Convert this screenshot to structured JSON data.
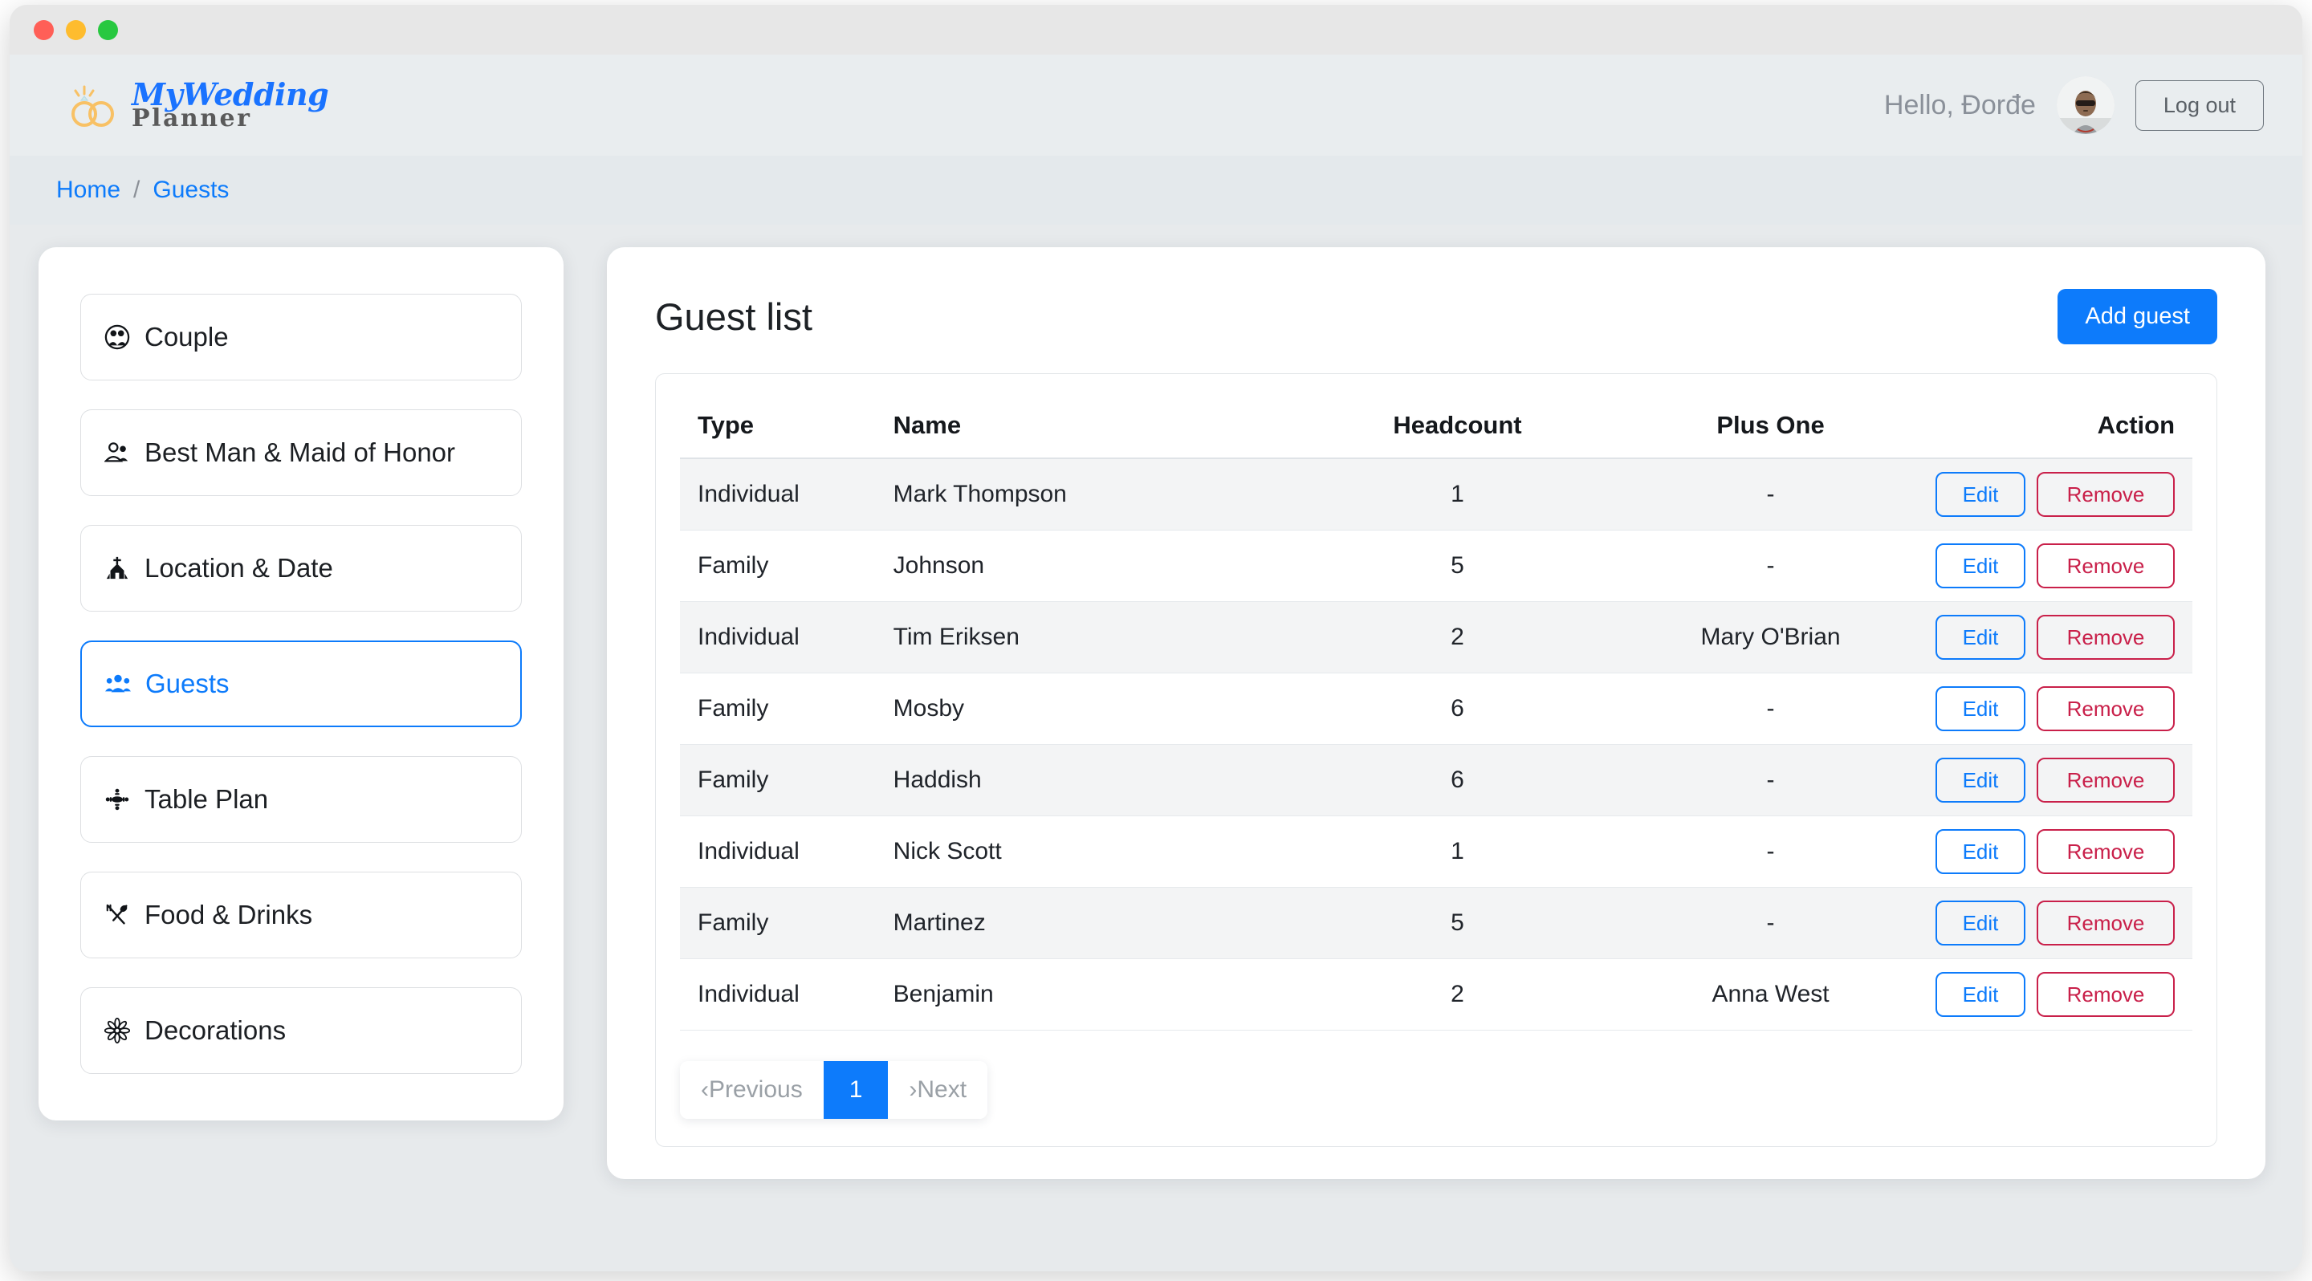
{
  "window": {
    "controls": [
      "close",
      "minimize",
      "maximize"
    ]
  },
  "header": {
    "logo": {
      "line1": "MyWedding",
      "line2": "Planner",
      "icon": "wedding-rings-icon",
      "color_blue": "#1a73ff",
      "color_grey": "#5a5a5a",
      "ring_color": "#f8c165"
    },
    "greeting": "Hello, Đorđe",
    "avatar_alt": "user-avatar",
    "logout_label": "Log out"
  },
  "breadcrumb": {
    "items": [
      {
        "label": "Home",
        "link": true
      },
      {
        "label": "Guests",
        "link": true
      }
    ],
    "separator": "/"
  },
  "sidebar": {
    "items": [
      {
        "label": "Couple",
        "icon": "couple-icon",
        "active": false
      },
      {
        "label": "Best Man & Maid of Honor",
        "icon": "two-people-icon",
        "active": false
      },
      {
        "label": "Location & Date",
        "icon": "church-icon",
        "active": false
      },
      {
        "label": "Guests",
        "icon": "guests-icon",
        "active": true
      },
      {
        "label": "Table Plan",
        "icon": "table-plan-icon",
        "active": false
      },
      {
        "label": "Food & Drinks",
        "icon": "cutlery-icon",
        "active": false
      },
      {
        "label": "Decorations",
        "icon": "flower-icon",
        "active": false
      }
    ]
  },
  "main": {
    "title": "Guest list",
    "add_button_label": "Add guest",
    "table": {
      "columns": [
        "Type",
        "Name",
        "Headcount",
        "Plus One",
        "Action"
      ],
      "rows": [
        {
          "type": "Individual",
          "name": "Mark Thompson",
          "headcount": "1",
          "plus_one": "-",
          "edit": "Edit",
          "remove": "Remove"
        },
        {
          "type": "Family",
          "name": "Johnson",
          "headcount": "5",
          "plus_one": "-",
          "edit": "Edit",
          "remove": "Remove"
        },
        {
          "type": "Individual",
          "name": "Tim Eriksen",
          "headcount": "2",
          "plus_one": "Mary O'Brian",
          "edit": "Edit",
          "remove": "Remove"
        },
        {
          "type": "Family",
          "name": "Mosby",
          "headcount": "6",
          "plus_one": "-",
          "edit": "Edit",
          "remove": "Remove"
        },
        {
          "type": "Family",
          "name": "Haddish",
          "headcount": "6",
          "plus_one": "-",
          "edit": "Edit",
          "remove": "Remove"
        },
        {
          "type": "Individual",
          "name": "Nick Scott",
          "headcount": "1",
          "plus_one": "-",
          "edit": "Edit",
          "remove": "Remove"
        },
        {
          "type": "Family",
          "name": "Martinez",
          "headcount": "5",
          "plus_one": "-",
          "edit": "Edit",
          "remove": "Remove"
        },
        {
          "type": "Individual",
          "name": "Benjamin",
          "headcount": "2",
          "plus_one": "Anna West",
          "edit": "Edit",
          "remove": "Remove"
        }
      ]
    },
    "pagination": {
      "previous_label": "‹Previous",
      "next_label": "›Next",
      "pages": [
        "1"
      ],
      "current_page": "1"
    }
  },
  "colors": {
    "accent_blue": "#0d7bfb",
    "danger_red": "#c9204a",
    "page_bg": "#e9edef",
    "card_bg": "#ffffff",
    "row_stripe": "#f3f4f5"
  }
}
